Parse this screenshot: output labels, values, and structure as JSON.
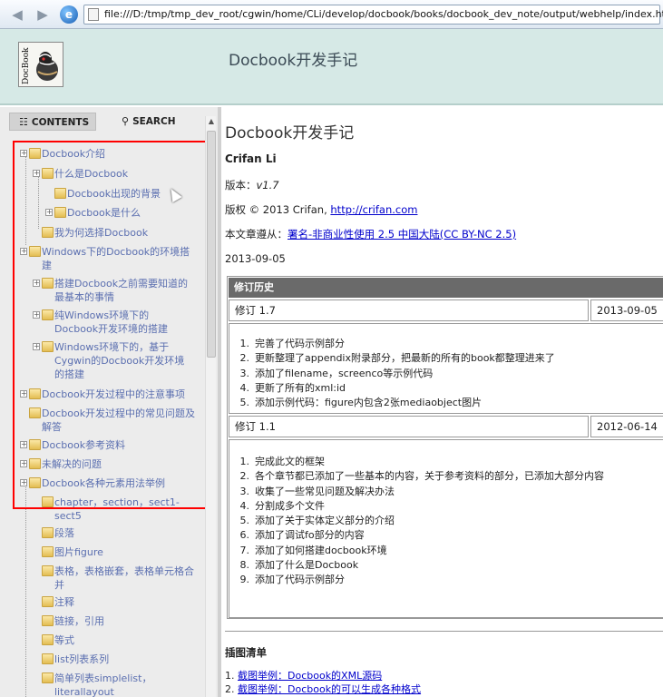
{
  "browser": {
    "url": "file:///D:/tmp/tmp_dev_root/cgwin/home/CLi/develop/docbook/books/docbook_dev_note/output/webhelp/index.html"
  },
  "header": {
    "logo_text": "DocBook",
    "title": "Docbook开发手记"
  },
  "sidebar": {
    "tabs": [
      {
        "label": "CONTENTS",
        "icon": "book-icon",
        "active": true
      },
      {
        "label": "SEARCH",
        "icon": "magnifier-icon",
        "active": false
      }
    ],
    "toc": [
      {
        "label": "Docbook介绍",
        "expander": true,
        "level": 0
      },
      {
        "label": "什么是Docbook",
        "expander": true,
        "level": 1
      },
      {
        "label": "Docbook出现的背景",
        "expander": false,
        "level": 2
      },
      {
        "label": "Docbook是什么",
        "expander": true,
        "level": 2
      },
      {
        "label": "我为何选择Docbook",
        "expander": false,
        "level": 1
      },
      {
        "label": "Windows下的Docbook的环境搭建",
        "expander": true,
        "level": 0
      },
      {
        "label": "搭建Docbook之前需要知道的最基本的事情",
        "expander": true,
        "level": 1
      },
      {
        "label": "纯Windows环境下的Docbook开发环境的搭建",
        "expander": true,
        "level": 1
      },
      {
        "label": "Windows环境下的，基于Cygwin的Docbook开发环境的搭建",
        "expander": true,
        "level": 1
      },
      {
        "label": "Docbook开发过程中的注意事项",
        "expander": true,
        "level": 0
      },
      {
        "label": "Docbook开发过程中的常见问题及解答",
        "expander": false,
        "level": 0
      },
      {
        "label": "Docbook参考资料",
        "expander": true,
        "level": 0
      },
      {
        "label": "未解决的问题",
        "expander": true,
        "level": 0
      },
      {
        "label": "Docbook各种元素用法举例",
        "expander": true,
        "level": 0
      },
      {
        "label": "chapter，section，sect1-sect5",
        "expander": false,
        "level": 1
      },
      {
        "label": "段落",
        "expander": false,
        "level": 1
      },
      {
        "label": "图片figure",
        "expander": false,
        "level": 1
      },
      {
        "label": "表格，表格嵌套，表格单元格合并",
        "expander": false,
        "level": 1
      },
      {
        "label": "注释",
        "expander": false,
        "level": 1
      },
      {
        "label": "链接，引用",
        "expander": false,
        "level": 1
      },
      {
        "label": "等式",
        "expander": false,
        "level": 1
      },
      {
        "label": "list列表系列",
        "expander": false,
        "level": 1
      },
      {
        "label": "简单列表simplelist，literallayout",
        "expander": false,
        "level": 1
      }
    ]
  },
  "main": {
    "title": "Docbook开发手记",
    "author": "Crifan Li",
    "version_label": "版本：",
    "version": "v1.7",
    "copyright_prefix": "版权 © 2013 Crifan, ",
    "copyright_link": "http://crifan.com",
    "license_prefix": "本文章遵从：",
    "license_link": "署名-非商业性使用 2.5 中国大陆(CC BY-NC 2.5)",
    "date": "2013-09-05",
    "history": {
      "heading": "修订历史",
      "revisions": [
        {
          "label": "修订 1.7",
          "date": "2013-09-05",
          "items": [
            "完善了代码示例部分",
            "更新整理了appendix附录部分，把最新的所有的book都整理进来了",
            "添加了filename，screenco等示例代码",
            "更新了所有的xml:id",
            "添加示例代码：figure内包含2张mediaobject图片"
          ]
        },
        {
          "label": "修订 1.1",
          "date": "2012-06-14",
          "items": [
            "完成此文的框架",
            "各个章节都已添加了一些基本的内容，关于参考资料的部分，已添加大部分内容",
            "收集了一些常见问题及解决办法",
            "分割成多个文件",
            "添加了关于实体定义部分的介绍",
            "添加了调试fo部分的内容",
            "添加了如何搭建docbook环境",
            "添加了什么是Docbook",
            "添加了代码示例部分"
          ]
        }
      ]
    },
    "figures": {
      "heading": "插图清单",
      "items": [
        "截图举例：Docbook的XML源码",
        "截图举例：Docbook的可以生成各种格式"
      ]
    }
  },
  "colors": {
    "header_bg": "#d6e9e6",
    "toc_link": "#5b6fb0",
    "link": "#0000cc",
    "highlight_box": "#ff0000",
    "table_head_bg": "#6a6a6a"
  }
}
